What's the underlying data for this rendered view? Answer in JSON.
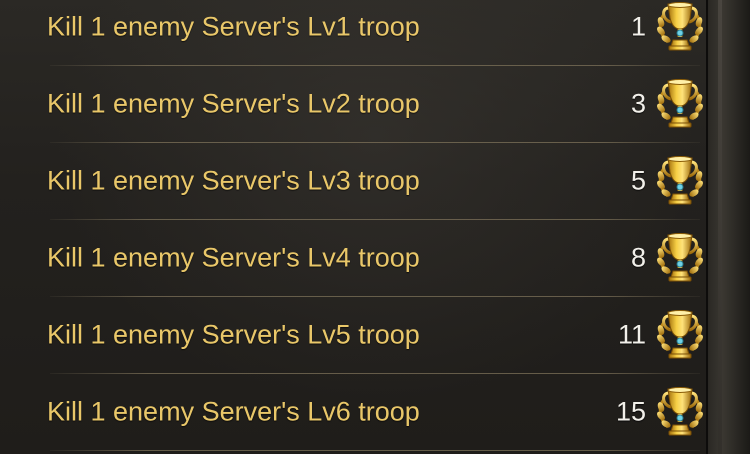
{
  "tasks": [
    {
      "label": "Kill 1 enemy Server's Lv1 troop",
      "count": "1",
      "icon": "trophy-icon"
    },
    {
      "label": "Kill 1 enemy Server's Lv2 troop",
      "count": "3",
      "icon": "trophy-icon"
    },
    {
      "label": "Kill 1 enemy Server's Lv3 troop",
      "count": "5",
      "icon": "trophy-icon"
    },
    {
      "label": "Kill 1 enemy Server's Lv4 troop",
      "count": "8",
      "icon": "trophy-icon"
    },
    {
      "label": "Kill 1 enemy Server's Lv5 troop",
      "count": "11",
      "icon": "trophy-icon"
    },
    {
      "label": "Kill 1 enemy Server's Lv6 troop",
      "count": "15",
      "icon": "trophy-icon"
    }
  ],
  "colors": {
    "label_text": "#e9c769",
    "count_text": "#f2f0ea",
    "trophy_gold": "#e8b421"
  }
}
